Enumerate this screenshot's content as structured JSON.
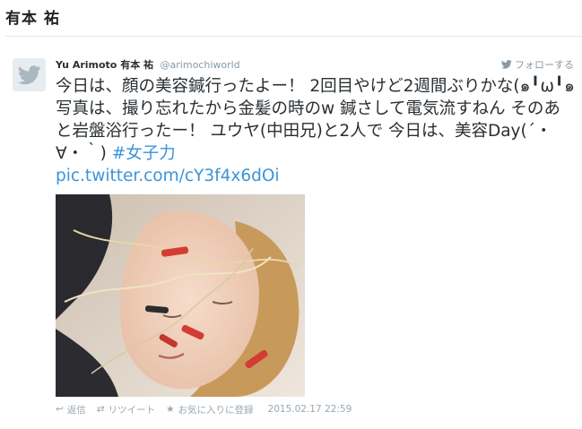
{
  "page": {
    "title": "有本 祐"
  },
  "tweet": {
    "display_name": "Yu Arimoto 有本 祐",
    "screen_name": "@arimochiworld",
    "follow_label": "フォローする",
    "text_main": "今日は、顔の美容鍼行ったよー！ 2回目やけど2週間ぶりかな(๑╹ω╹๑ 写真は、撮り忘れたから金髪の時のw 鍼さして電気流すねん そのあと岩盤浴行ったー！ ユウヤ(中田兄)と2人で 今日は、美容Day(´・∀・｀) ",
    "hashtag": "#女子力",
    "link": "pic.twitter.com/cY3f4x6dOi",
    "photo_alt": "",
    "actions": {
      "reply": "返信",
      "retweet": "リツイート",
      "favorite": "お気に入りに登録"
    },
    "timestamp": "2015.02.17 22:59"
  },
  "colors": {
    "link": "#3b94d9",
    "muted": "#8899a6",
    "text": "#292f33",
    "border": "#e1e8ed"
  }
}
